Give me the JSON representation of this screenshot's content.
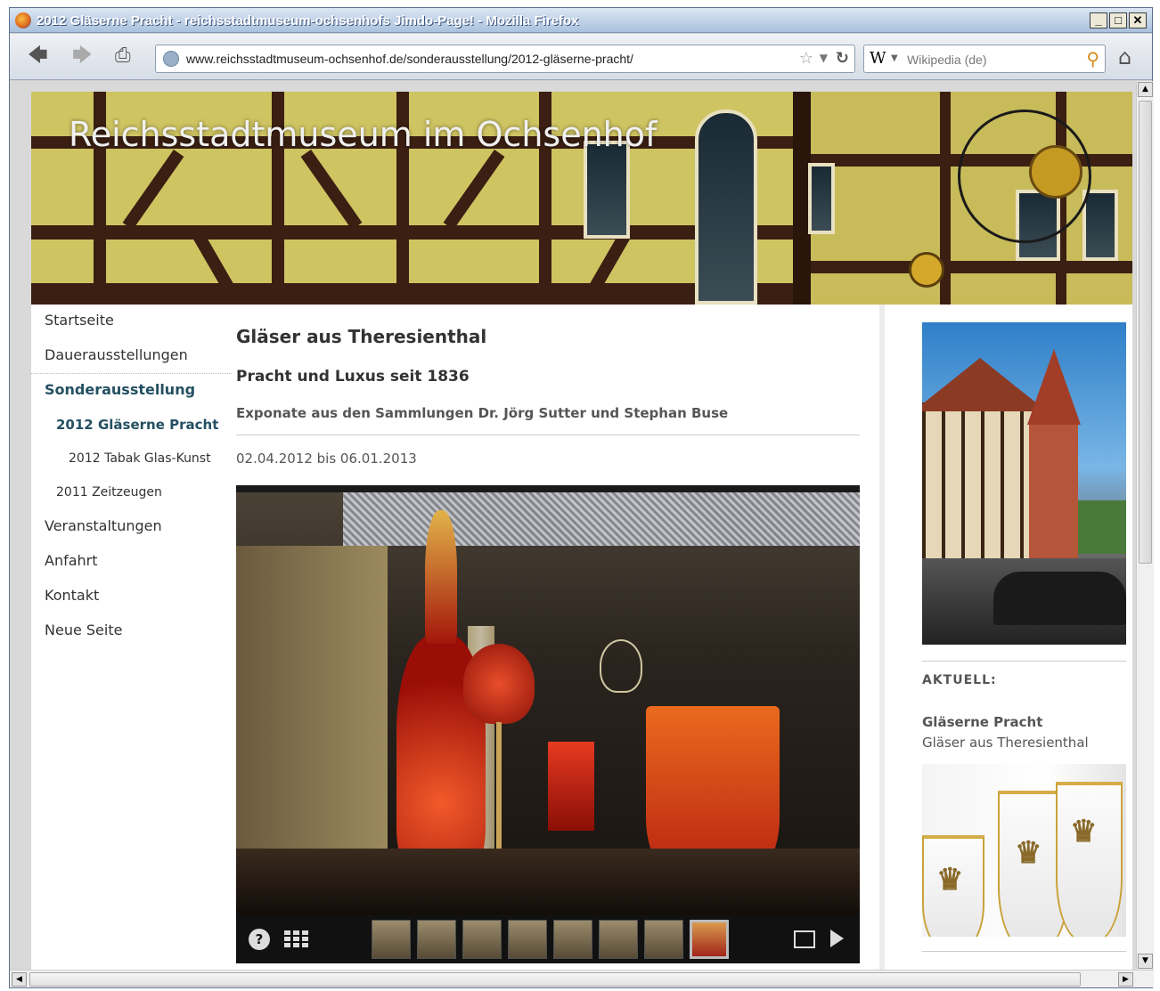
{
  "browser": {
    "window_title": "2012 Gläserne Pracht - reichsstadtmuseum-ochsenhofs Jimdo-Page! - Mozilla Firefox",
    "url": "www.reichsstadtmuseum-ochsenhof.de/sonderausstellung/2012-gläserne-pracht/",
    "search_engine_letter": "W",
    "search_placeholder": "Wikipedia (de)",
    "controls": {
      "minimize": "_",
      "maximize": "□",
      "close": "✕"
    }
  },
  "site": {
    "title": "Reichsstadtmuseum im Ochsenhof"
  },
  "nav": {
    "items": [
      {
        "label": "Startseite"
      },
      {
        "label": "Dauerausstellungen"
      },
      {
        "label": "Sonderausstellung"
      },
      {
        "label": "2012 Gläserne Pracht"
      },
      {
        "label": "2012 Tabak Glas-Kunst"
      },
      {
        "label": "2011 Zeitzeugen"
      },
      {
        "label": "Veranstaltungen"
      },
      {
        "label": "Anfahrt"
      },
      {
        "label": "Kontakt"
      },
      {
        "label": "Neue Seite"
      }
    ]
  },
  "content": {
    "heading": "Gläser aus Theresienthal",
    "subheading": "Pracht und Luxus seit 1836",
    "exhibits": "Exponate aus den Sammlungen Dr. Jörg Sutter und Stephan Buse",
    "dates": "02.04.2012 bis 06.01.2013",
    "gallery": {
      "help_label": "?",
      "thumbnail_count": 8,
      "active_thumbnail": 8
    }
  },
  "sidebar": {
    "section_label": "AKTUELL:",
    "news_title": "Gläserne Pracht",
    "news_subtitle": "Gläser aus Theresienthal"
  },
  "colors": {
    "nav_active": "#245061",
    "titlebar": "#a9c1de",
    "header_panel": "#d9cf6a"
  }
}
